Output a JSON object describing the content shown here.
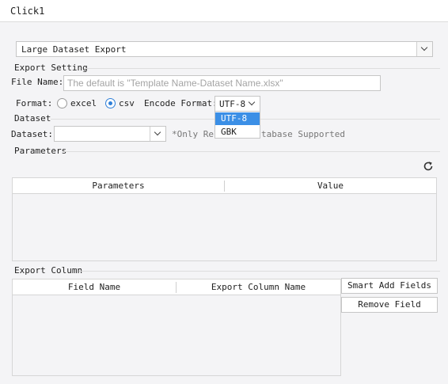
{
  "window": {
    "title": "Click1"
  },
  "export_type": {
    "selected": "Large Dataset Export"
  },
  "export_setting": {
    "section_title": "Export Setting",
    "file_name_label": "File Name:",
    "file_name_placeholder": "The default is \"Template Name-Dataset Name.xlsx\"",
    "format_label": "Format:",
    "format_options": [
      "excel",
      "csv"
    ],
    "format_selected": "csv",
    "encode_label": "Encode Format:",
    "encode_selected": "UTF-8",
    "encode_options": [
      "UTF-8",
      "GBK"
    ]
  },
  "dataset": {
    "section_title": "Dataset",
    "label": "Dataset:",
    "value": "",
    "note": "*Only Rel",
    "note_tail": "tabase Supported"
  },
  "parameters": {
    "section_title": "Parameters",
    "columns": [
      "Parameters",
      "Value"
    ],
    "rows": []
  },
  "export_column": {
    "section_title": "Export Column",
    "columns": [
      "Field Name",
      "Export Column Name"
    ],
    "rows": [],
    "smart_add_label": "Smart Add Fields",
    "remove_label": "Remove Field"
  },
  "icons": {
    "refresh": "refresh-icon",
    "dropdown": "chevron-down-icon"
  },
  "colors": {
    "accent": "#3b8fe6",
    "background": "#f4f4f6"
  }
}
